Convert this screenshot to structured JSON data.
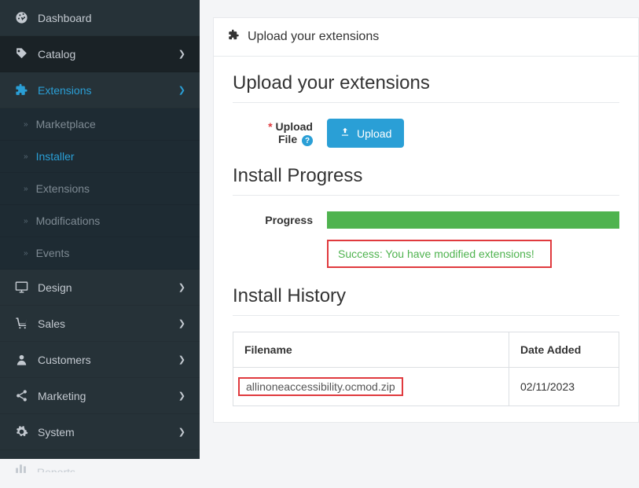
{
  "sidebar": {
    "dashboard": "Dashboard",
    "catalog": "Catalog",
    "extensions": "Extensions",
    "sub": {
      "marketplace": "Marketplace",
      "installer": "Installer",
      "extensions": "Extensions",
      "modifications": "Modifications",
      "events": "Events"
    },
    "design": "Design",
    "sales": "Sales",
    "customers": "Customers",
    "marketing": "Marketing",
    "system": "System",
    "reports": "Reports"
  },
  "panel": {
    "header": "Upload your extensions",
    "upload_title": "Upload your extensions",
    "upload_label_line1": "Upload",
    "upload_label_line2": "File",
    "upload_button": "Upload",
    "progress_title": "Install Progress",
    "progress_label": "Progress",
    "success_msg": "Success: You have modified extensions!",
    "history_title": "Install History",
    "history": {
      "col_filename": "Filename",
      "col_date": "Date Added",
      "rows": [
        {
          "filename": "allinoneaccessibility.ocmod.zip",
          "date": "02/11/2023"
        }
      ]
    }
  }
}
